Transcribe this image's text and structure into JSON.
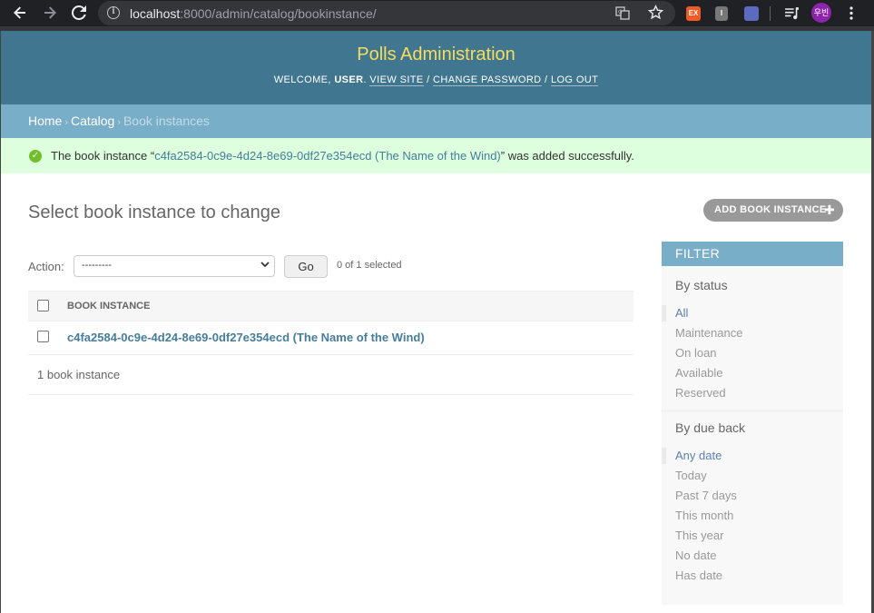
{
  "browser": {
    "url_host": "localhost",
    "url_rest": ":8000/admin/catalog/bookinstance/",
    "profile_label": "우빈",
    "ext1_label": "EX",
    "ext2_label": "I"
  },
  "header": {
    "site_name": "Polls Administration",
    "welcome": "Welcome,",
    "user": "user",
    "view_site": "View site",
    "change_password": "Change password",
    "log_out": "Log out"
  },
  "breadcrumbs": {
    "home": "Home",
    "catalog": "Catalog",
    "current": "Book instances"
  },
  "message": {
    "prefix": "The book instance “",
    "link": "c4fa2584-0c9e-4d24-8e69-0df27e354ecd (The Name of the Wind)",
    "suffix": "” was added successfully."
  },
  "content": {
    "title": "Select book instance to change",
    "add_button": "Add book instance"
  },
  "actions": {
    "label": "Action:",
    "selected_option": "---------",
    "go": "Go",
    "counter": "0 of 1 selected"
  },
  "table": {
    "column_header": "Book instance",
    "rows": [
      {
        "label": "c4fa2584-0c9e-4d24-8e69-0df27e354ecd (The Name of the Wind)"
      }
    ],
    "paginator": "1 book instance"
  },
  "filter": {
    "title": "Filter",
    "sections": [
      {
        "heading": "By status",
        "options": [
          "All",
          "Maintenance",
          "On loan",
          "Available",
          "Reserved"
        ],
        "selected": 0
      },
      {
        "heading": "By due back",
        "options": [
          "Any date",
          "Today",
          "Past 7 days",
          "This month",
          "This year",
          "No date",
          "Has date"
        ],
        "selected": 0
      }
    ]
  },
  "colors": {
    "header_bg": "#417690",
    "site_name": "#f5dd5d",
    "breadcrumb_bg": "#79aec8",
    "success_bg": "#dddddd",
    "link": "#447e9b"
  }
}
